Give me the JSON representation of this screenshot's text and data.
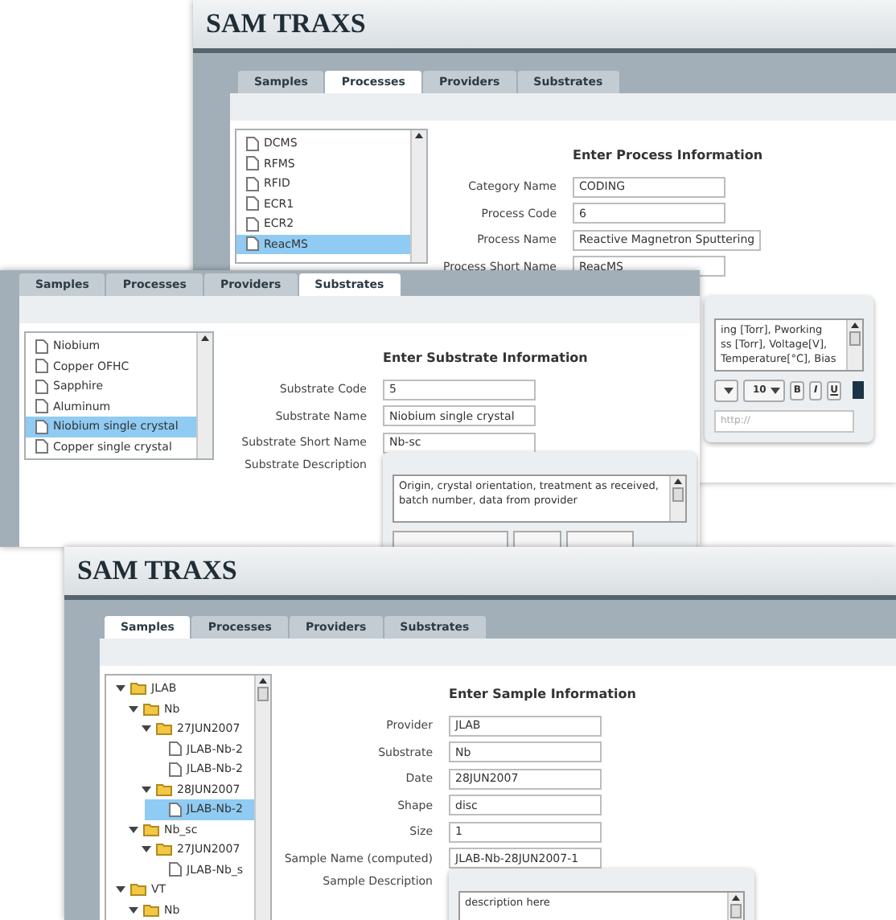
{
  "windows": [
    {
      "title": "SAM TRAXS",
      "tabs": [
        {
          "label": "Samples",
          "selected": false
        },
        {
          "label": "Processes",
          "selected": true
        },
        {
          "label": "Providers",
          "selected": false
        },
        {
          "label": "Substrates",
          "selected": false
        }
      ],
      "sidebar": {
        "kind": "list",
        "items": [
          {
            "label": "DCMS",
            "selected": false
          },
          {
            "label": "RFMS",
            "selected": false
          },
          {
            "label": "RFID",
            "selected": false
          },
          {
            "label": "ECR1",
            "selected": false
          },
          {
            "label": "ECR2",
            "selected": false
          },
          {
            "label": "ReacMS",
            "selected": true
          }
        ]
      },
      "form": {
        "heading": "Enter Process Information",
        "fields": [
          {
            "label": "Category Name",
            "value": "CODING"
          },
          {
            "label": "Process Code",
            "value": "6"
          },
          {
            "label": "Process Name",
            "value": "Reactive Magnetron Sputtering"
          },
          {
            "label": "Process Short Name",
            "value": "ReacMS"
          }
        ],
        "editor": {
          "lines": [
            "ing [Torr], Pworking",
            "ss [Torr], Voltage[V],",
            "Temperature[°C], Bias"
          ],
          "font_size": "10",
          "format_buttons": [
            "B",
            "I",
            "U"
          ],
          "link_placeholder": "http://"
        }
      }
    },
    {
      "tabs": [
        {
          "label": "Samples",
          "selected": false
        },
        {
          "label": "Processes",
          "selected": false
        },
        {
          "label": "Providers",
          "selected": false
        },
        {
          "label": "Substrates",
          "selected": true
        }
      ],
      "sidebar": {
        "kind": "list",
        "items": [
          {
            "label": "Niobium",
            "selected": false
          },
          {
            "label": "Copper OFHC",
            "selected": false
          },
          {
            "label": "Sapphire",
            "selected": false
          },
          {
            "label": "Aluminum",
            "selected": false
          },
          {
            "label": "Niobium single crystal",
            "selected": true
          },
          {
            "label": "Copper single crystal",
            "selected": false
          }
        ]
      },
      "form": {
        "heading": "Enter Substrate Information",
        "fields": [
          {
            "label": "Substrate Code",
            "value": "5"
          },
          {
            "label": "Substrate Name",
            "value": "Niobium single crystal"
          },
          {
            "label": "Substrate Short Name",
            "value": "Nb-sc"
          }
        ],
        "description_label": "Substrate Description",
        "editor": {
          "text": "Origin, crystal orientation, treatment as received, batch number, data from provider"
        }
      }
    },
    {
      "title": "SAM TRAXS",
      "tabs": [
        {
          "label": "Samples",
          "selected": true
        },
        {
          "label": "Processes",
          "selected": false
        },
        {
          "label": "Providers",
          "selected": false
        },
        {
          "label": "Substrates",
          "selected": false
        }
      ],
      "sidebar": {
        "kind": "tree",
        "items": [
          {
            "label": "JLAB",
            "kind": "folder",
            "expanded": true,
            "selected": false,
            "children": [
              {
                "label": "Nb",
                "kind": "folder",
                "expanded": true,
                "selected": false,
                "children": [
                  {
                    "label": "27JUN2007",
                    "kind": "folder",
                    "expanded": true,
                    "selected": false,
                    "children": [
                      {
                        "label": "JLAB-Nb-2",
                        "kind": "file",
                        "selected": false
                      },
                      {
                        "label": "JLAB-Nb-2",
                        "kind": "file",
                        "selected": false
                      }
                    ]
                  },
                  {
                    "label": "28JUN2007",
                    "kind": "folder",
                    "expanded": true,
                    "selected": false,
                    "children": [
                      {
                        "label": "JLAB-Nb-2",
                        "kind": "file",
                        "selected": true
                      }
                    ]
                  }
                ]
              },
              {
                "label": "Nb_sc",
                "kind": "folder",
                "expanded": true,
                "selected": false,
                "children": [
                  {
                    "label": "27JUN2007",
                    "kind": "folder",
                    "expanded": true,
                    "selected": false,
                    "children": [
                      {
                        "label": "JLAB-Nb_s",
                        "kind": "file",
                        "selected": false
                      }
                    ]
                  }
                ]
              }
            ]
          },
          {
            "label": "VT",
            "kind": "folder",
            "expanded": true,
            "selected": false,
            "children": [
              {
                "label": "Nb",
                "kind": "folder",
                "expanded": true,
                "selected": false
              }
            ]
          }
        ]
      },
      "form": {
        "heading": "Enter Sample Information",
        "fields": [
          {
            "label": "Provider",
            "value": "JLAB"
          },
          {
            "label": "Substrate",
            "value": "Nb"
          },
          {
            "label": "Date",
            "value": "28JUN2007"
          },
          {
            "label": "Shape",
            "value": "disc"
          },
          {
            "label": "Size",
            "value": "1"
          },
          {
            "label": "Sample Name (computed)",
            "value": "JLAB-Nb-28JUN2007-1"
          }
        ],
        "description_label": "Sample Description",
        "editor": {
          "text": "description here"
        }
      }
    }
  ]
}
